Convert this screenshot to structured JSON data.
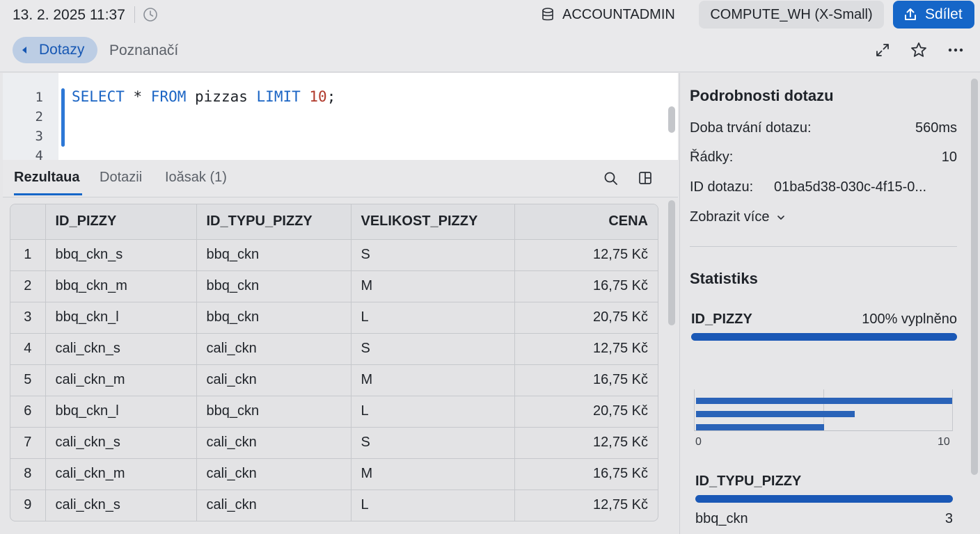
{
  "top_bar": {
    "timestamp": "13. 2. 2025 11:37",
    "role": "ACCOUNTADMIN",
    "warehouse": "COMPUTE_WH (X-Small)",
    "share_label": "Sdílet"
  },
  "nav": {
    "back_label": "Dotazy",
    "notes_label": "Poznanačí"
  },
  "editor": {
    "line_numbers": [
      "1",
      "2",
      "3",
      "4"
    ],
    "code": {
      "kw_select": "SELECT",
      "star": " * ",
      "kw_from": "FROM",
      "table": " pizzas ",
      "kw_limit": "LIMIT",
      "limit_value": " 10",
      "terminator": ";"
    }
  },
  "result_tabs": [
    {
      "label": "Rezultaua",
      "active": true
    },
    {
      "label": "Dotazii",
      "active": false
    },
    {
      "label": "Ioăsak (1)",
      "active": false
    }
  ],
  "table": {
    "columns": [
      "",
      "ID_PIZZY",
      "ID_TYPU_PIZZY",
      "VELIKOST_PIZZY",
      "CENA"
    ],
    "rows": [
      [
        "1",
        "bbq_ckn_s",
        "bbq_ckn",
        "S",
        "12,75 Kč"
      ],
      [
        "2",
        "bbq_ckn_m",
        "bbq_ckn",
        "M",
        "16,75 Kč"
      ],
      [
        "3",
        "bbq_ckn_l",
        "bbq_ckn",
        "L",
        "20,75 Kč"
      ],
      [
        "4",
        "cali_ckn_s",
        "cali_ckn",
        "S",
        "12,75 Kč"
      ],
      [
        "5",
        "cali_ckn_m",
        "cali_ckn",
        "M",
        "16,75 Kč"
      ],
      [
        "6",
        "bbq_ckn_l",
        "bbq_ckn",
        "L",
        "20,75 Kč"
      ],
      [
        "7",
        "cali_ckn_s",
        "cali_ckn",
        "S",
        "12,75 Kč"
      ],
      [
        "8",
        "cali_ckn_m",
        "cali_ckn",
        "M",
        "16,75 Kč"
      ],
      [
        "9",
        "cali_ckn_s",
        "cali_ckn",
        "L",
        "12,75 Kč"
      ]
    ]
  },
  "details": {
    "title": "Podrobnosti dotazu",
    "duration_label": "Doba trvání dotazu:",
    "duration_value": "560ms",
    "rows_label": "Řádky:",
    "rows_value": "10",
    "query_id_label": "ID dotazu:",
    "query_id_value": "01ba5d38-030c-4f15-0...",
    "show_more_label": "Zobrazit více"
  },
  "statistics": {
    "title": "Statistiks",
    "column1": {
      "name": "ID_PIZZY",
      "fill_text": "100% vyplněno",
      "fill_fraction": 1.0,
      "histogram": {
        "axis_min": "0",
        "axis_max": "10",
        "range": [
          0,
          10
        ],
        "bars": [
          10,
          6.2,
          5
        ]
      }
    },
    "column2": {
      "name": "ID_TYPU_PIZZY",
      "fill_fraction": 1.0,
      "top_value": "bbq_ckn",
      "top_count": "3"
    }
  },
  "colors": {
    "accent": "#1566c8",
    "keyword": "#1a64c4",
    "number": "#b0382a",
    "stat_bar": "#1a58b6"
  }
}
